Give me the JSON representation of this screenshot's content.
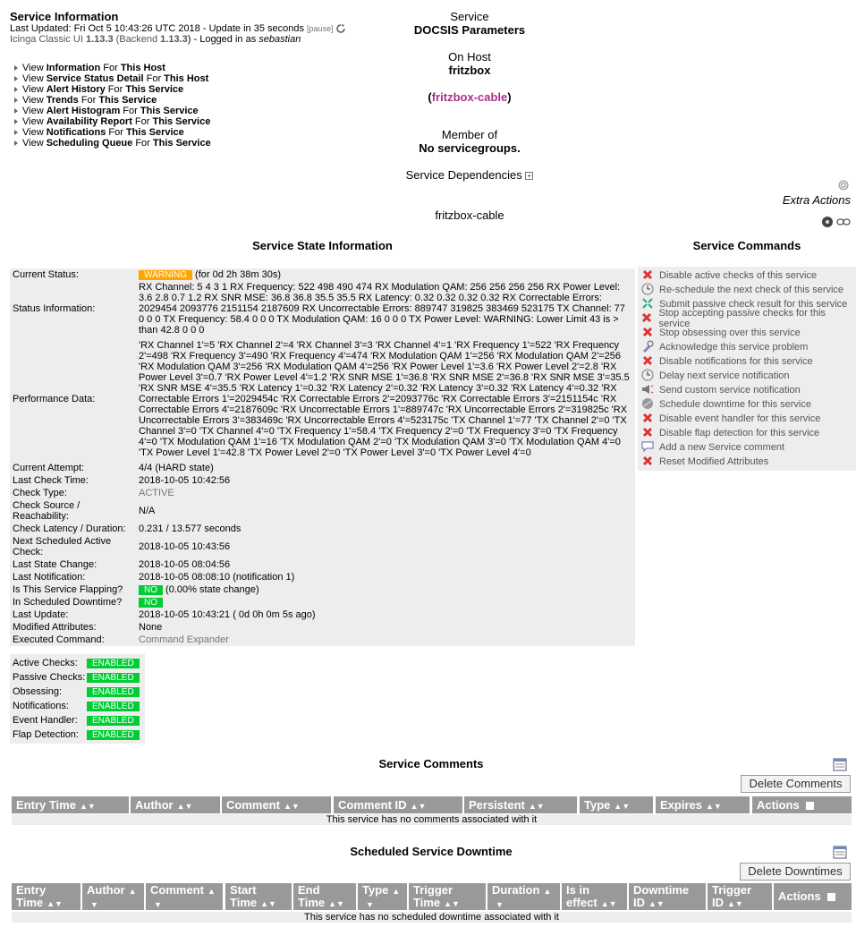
{
  "header": {
    "title": "Service Information",
    "last_updated_prefix": "Last Updated: ",
    "last_updated": "Fri Oct 5 10:43:26 UTC 2018",
    "update_text": " - Update in 35 seconds ",
    "pause_label": "[pause]",
    "ui_prefix": "Icinga Classic UI ",
    "ui_version": "1.13.3",
    "backend_prefix": " (Backend ",
    "backend_version": "1.13.3",
    "logged_in_prefix": ") - Logged in as ",
    "user": "sebastian"
  },
  "nav_links": [
    {
      "pre": "View ",
      "bold": "Information",
      "mid": " For ",
      "target": "This Host"
    },
    {
      "pre": "View ",
      "bold": "Service Status Detail",
      "mid": " For ",
      "target": "This Host"
    },
    {
      "pre": "View ",
      "bold": "Alert History",
      "mid": " For ",
      "target": "This Service"
    },
    {
      "pre": "View ",
      "bold": "Trends",
      "mid": " For ",
      "target": "This Service"
    },
    {
      "pre": "View ",
      "bold": "Alert Histogram",
      "mid": " For ",
      "target": "This Service"
    },
    {
      "pre": "View ",
      "bold": "Availability Report",
      "mid": " For ",
      "target": "This Service"
    },
    {
      "pre": "View ",
      "bold": "Notifications",
      "mid": " For ",
      "target": "This Service"
    },
    {
      "pre": "View ",
      "bold": "Scheduling Queue",
      "mid": " For ",
      "target": "This Service"
    }
  ],
  "service_box": {
    "service_label": "Service",
    "service_name": "DOCSIS Parameters",
    "host_label": "On Host",
    "host_name": "fritzbox",
    "host_link": "fritzbox-cable",
    "paren_open": "(",
    "paren_close": ")",
    "member_label": "Member of",
    "member_value": "No servicegroups.",
    "deps_label": "Service Dependencies",
    "bottom_host": "fritzbox-cable"
  },
  "extra_actions": "Extra Actions",
  "state_section_title": "Service State Information",
  "commands_section_title": "Service Commands",
  "state_rows": [
    {
      "k": "Current Status:",
      "badge": "WARNING",
      "v": " (for 0d 2h 38m 30s)"
    },
    {
      "k": "Status Information:",
      "v": "RX Channel: 5 4 3 1 RX Frequency: 522 498 490 474 RX Modulation QAM: 256 256 256 256 RX Power Level: 3.6 2.8 0.7 1.2 RX SNR MSE: 36.8 36.8 35.5 35.5 RX Latency: 0.32 0.32 0.32 0.32 RX Correctable Errors: 2029454 2093776 2151154 2187609 RX Uncorrectable Errors: 889747 319825 383469 523175 TX Channel: 77 0 0 0 TX Frequency: 58.4 0 0 0 TX Modulation QAM: 16 0 0 0 TX Power Level: WARNING: Lower Limit 43 is > than 42.8 0 0 0"
    },
    {
      "k": "Performance Data:",
      "v": "'RX Channel 1'=5 'RX Channel 2'=4 'RX Channel 3'=3 'RX Channel 4'=1 'RX Frequency 1'=522 'RX Frequency 2'=498 'RX Frequency 3'=490 'RX Frequency 4'=474 'RX Modulation QAM 1'=256 'RX Modulation QAM 2'=256 'RX Modulation QAM 3'=256 'RX Modulation QAM 4'=256 'RX Power Level 1'=3.6 'RX Power Level 2'=2.8 'RX Power Level 3'=0.7 'RX Power Level 4'=1.2 'RX SNR MSE 1'=36.8 'RX SNR MSE 2'=36.8 'RX SNR MSE 3'=35.5 'RX SNR MSE 4'=35.5 'RX Latency 1'=0.32 'RX Latency 2'=0.32 'RX Latency 3'=0.32 'RX Latency 4'=0.32 'RX Correctable Errors 1'=2029454c 'RX Correctable Errors 2'=2093776c 'RX Correctable Errors 3'=2151154c 'RX Correctable Errors 4'=2187609c 'RX Uncorrectable Errors 1'=889747c 'RX Uncorrectable Errors 2'=319825c 'RX Uncorrectable Errors 3'=383469c 'RX Uncorrectable Errors 4'=523175c 'TX Channel 1'=77 'TX Channel 2'=0 'TX Channel 3'=0 'TX Channel 4'=0 'TX Frequency 1'=58.4 'TX Frequency 2'=0 'TX Frequency 3'=0 'TX Frequency 4'=0 'TX Modulation QAM 1'=16 'TX Modulation QAM 2'=0 'TX Modulation QAM 3'=0 'TX Modulation QAM 4'=0 'TX Power Level 1'=42.8 'TX Power Level 2'=0 'TX Power Level 3'=0 'TX Power Level 4'=0"
    },
    {
      "k": "Current Attempt:",
      "v": "4/4  (HARD state)"
    },
    {
      "k": "Last Check Time:",
      "v": "2018-10-05 10:42:56"
    },
    {
      "k": "Check Type:",
      "v": "ACTIVE",
      "gray": true
    },
    {
      "k": "Check Source / Reachability:",
      "v": "N/A"
    },
    {
      "k": "Check Latency / Duration:",
      "v": "0.231 / 13.577 seconds"
    },
    {
      "k": "Next Scheduled Active Check:",
      "v": "2018-10-05 10:43:56"
    },
    {
      "k": "Last State Change:",
      "v": "2018-10-05 08:04:56"
    },
    {
      "k": "Last Notification:",
      "v": "2018-10-05 08:08:10 (notification 1)"
    },
    {
      "k": "Is This Service Flapping?",
      "badge": "NO",
      "badge_ok": true,
      "v": " (0.00% state change)"
    },
    {
      "k": "In Scheduled Downtime?",
      "badge": "NO",
      "badge_ok": true,
      "v": ""
    },
    {
      "k": "Last Update:",
      "v": "2018-10-05 10:43:21  ( 0d 0h 0m 5s ago)"
    },
    {
      "k": "Modified Attributes:",
      "v": "None"
    },
    {
      "k": "Executed Command:",
      "v": "Command Expander",
      "gray": true
    }
  ],
  "checks": [
    {
      "k": "Active Checks:",
      "v": "ENABLED"
    },
    {
      "k": "Passive Checks:",
      "v": "ENABLED"
    },
    {
      "k": "Obsessing:",
      "v": "ENABLED"
    },
    {
      "k": "Notifications:",
      "v": "ENABLED"
    },
    {
      "k": "Event Handler:",
      "v": "ENABLED"
    },
    {
      "k": "Flap Detection:",
      "v": "ENABLED"
    }
  ],
  "commands": [
    {
      "icon": "x",
      "label": "Disable active checks of this service"
    },
    {
      "icon": "clock",
      "label": "Re-schedule the next check of this service"
    },
    {
      "icon": "passive",
      "label": "Submit passive check result for this service"
    },
    {
      "icon": "x",
      "label": "Stop accepting passive checks for this service"
    },
    {
      "icon": "x",
      "label": "Stop obsessing over this service"
    },
    {
      "icon": "ack",
      "label": "Acknowledge this service problem"
    },
    {
      "icon": "x",
      "label": "Disable notifications for this service"
    },
    {
      "icon": "clock",
      "label": "Delay next service notification"
    },
    {
      "icon": "notify",
      "label": "Send custom service notification"
    },
    {
      "icon": "downtime",
      "label": "Schedule downtime for this service"
    },
    {
      "icon": "x",
      "label": "Disable event handler for this service"
    },
    {
      "icon": "x",
      "label": "Disable flap detection for this service"
    },
    {
      "icon": "comment",
      "label": "Add a new Service comment"
    },
    {
      "icon": "x",
      "label": "Reset Modified Attributes"
    }
  ],
  "comments": {
    "title": "Service Comments",
    "delete_button": "Delete Comments",
    "columns": [
      "Entry Time",
      "Author",
      "Comment",
      "Comment ID",
      "Persistent",
      "Type",
      "Expires",
      "Actions"
    ],
    "empty_message": "This service has no comments associated with it"
  },
  "downtime": {
    "title": "Scheduled Service Downtime",
    "delete_button": "Delete Downtimes",
    "columns": [
      [
        "Entry",
        "Time"
      ],
      [
        "Author",
        ""
      ],
      [
        "Comment",
        ""
      ],
      [
        "Start",
        "Time"
      ],
      [
        "End",
        "Time"
      ],
      [
        "Type",
        ""
      ],
      [
        "Trigger",
        "Time"
      ],
      [
        "Duration",
        ""
      ],
      [
        "Is in",
        "effect"
      ],
      [
        "Downtime",
        "ID"
      ],
      [
        "Trigger",
        "ID"
      ],
      [
        "Actions",
        ""
      ]
    ],
    "empty_message": "This service has no scheduled downtime associated with it"
  },
  "colors": {
    "warning": "#ffa500",
    "ok": "#00cc33",
    "header_bg": "#999999",
    "row_bg": "#ededed",
    "link": "#a8328a"
  }
}
